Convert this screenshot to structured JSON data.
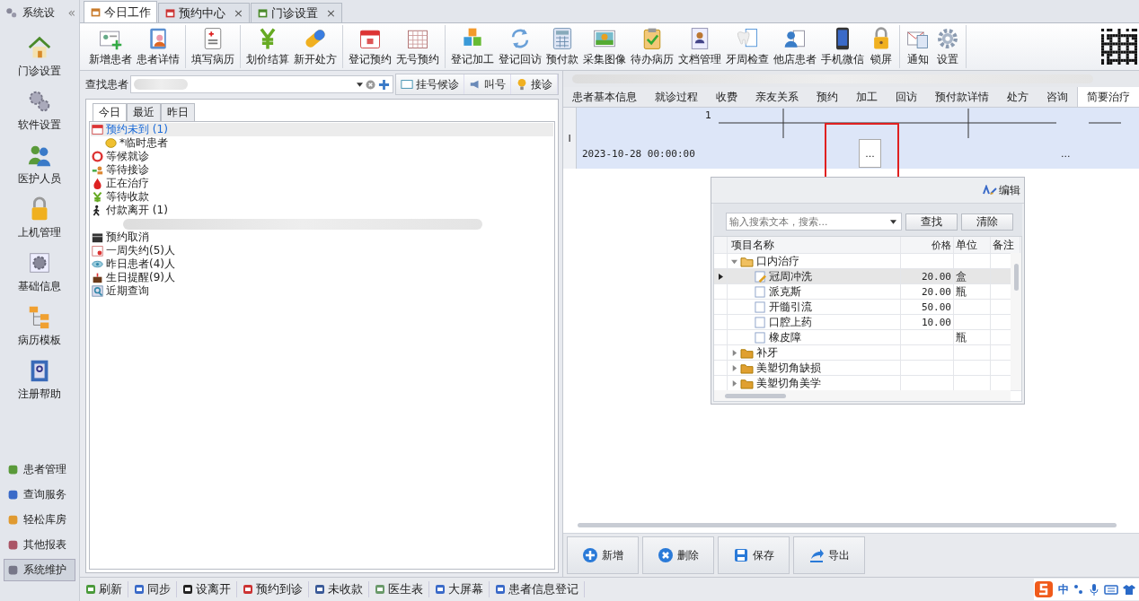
{
  "sidebar": {
    "title": "系统设",
    "collapse": "«",
    "items": [
      {
        "label": "门诊设置"
      },
      {
        "label": "软件设置"
      },
      {
        "label": "医护人员"
      },
      {
        "label": "上机管理"
      },
      {
        "label": "基础信息"
      },
      {
        "label": "病历模板"
      },
      {
        "label": "注册帮助"
      }
    ],
    "modules": [
      {
        "label": "患者管理",
        "selected": false
      },
      {
        "label": "查询服务",
        "selected": false
      },
      {
        "label": "轻松库房",
        "selected": false
      },
      {
        "label": "其他报表",
        "selected": false
      },
      {
        "label": "系统维护",
        "selected": true
      }
    ]
  },
  "tabs": [
    {
      "label": "今日工作",
      "selected": true,
      "closable": false
    },
    {
      "label": "预约中心",
      "selected": false,
      "closable": true
    },
    {
      "label": "门诊设置",
      "selected": false,
      "closable": true
    }
  ],
  "tab_close": "×",
  "toolbar": [
    [
      "新增患者",
      "患者详情"
    ],
    [
      "填写病历"
    ],
    [
      "划价结算",
      "新开处方"
    ],
    [
      "登记预约",
      "无号预约"
    ],
    [
      "登记加工",
      "登记回访",
      "预付款",
      "采集图像",
      "待办病历",
      "文档管理",
      "牙周检查",
      "他店患者",
      "手机微信",
      "锁屏"
    ],
    [
      "通知",
      "设置"
    ]
  ],
  "patient_search": {
    "label": "查找患者",
    "buttons": [
      "挂号候诊",
      "叫号",
      "接诊"
    ]
  },
  "queue": {
    "tabs": [
      {
        "label": "今日",
        "selected": true
      },
      {
        "label": "最近",
        "selected": false
      },
      {
        "label": "昨日",
        "selected": false
      }
    ],
    "items": [
      {
        "label": "预约未到 (1)",
        "selected": true,
        "children": [
          {
            "label": "*临时患者",
            "kind": "patient"
          }
        ]
      },
      {
        "label": "等候就诊",
        "selected": false
      },
      {
        "label": "等待接诊",
        "selected": false
      },
      {
        "label": "正在治疗",
        "selected": false
      },
      {
        "label": "等待收款",
        "selected": false
      },
      {
        "label": "付款离开 (1)",
        "selected": false,
        "children": [
          {
            "kind": "blurred"
          }
        ]
      },
      {
        "label": "预约取消",
        "selected": false
      },
      {
        "label": "一周失约(5)人",
        "selected": false
      },
      {
        "label": "昨日患者(4)人",
        "selected": false
      },
      {
        "label": "生日提醒(9)人",
        "selected": false
      },
      {
        "label": "近期查询",
        "selected": false
      }
    ]
  },
  "detail": {
    "tabs": [
      {
        "label": "患者基本信息",
        "selected": false
      },
      {
        "label": "就诊过程",
        "selected": false
      },
      {
        "label": "收费",
        "selected": false
      },
      {
        "label": "亲友关系",
        "selected": false
      },
      {
        "label": "预约",
        "selected": false
      },
      {
        "label": "加工",
        "selected": false
      },
      {
        "label": "回访",
        "selected": false
      },
      {
        "label": "预付款详情",
        "selected": false
      },
      {
        "label": "处方",
        "selected": false
      },
      {
        "label": "咨询",
        "selected": false
      },
      {
        "label": "简要治疗",
        "selected": true
      }
    ],
    "record": {
      "row_marker": "I",
      "number": "1",
      "datetime": "2023-10-28 00:00:00",
      "edit_button": "...",
      "more": "..."
    },
    "highlight": true,
    "picker": {
      "edit": "编辑",
      "search_placeholder": "输入搜索文本，搜索...",
      "find": "查找",
      "clear": "清除",
      "columns": [
        "项目名称",
        "价格",
        "单位",
        "备注"
      ],
      "groups": [
        {
          "name": "口内治疗",
          "expanded": true,
          "items": [
            {
              "name": "冠周冲洗",
              "price": "20.00",
              "unit": "盒",
              "selected": true
            },
            {
              "name": "派克斯",
              "price": "20.00",
              "unit": "瓶",
              "selected": false
            },
            {
              "name": "开髓引流",
              "price": "50.00",
              "selected": false
            },
            {
              "name": "口腔上药",
              "price": "10.00",
              "selected": false
            },
            {
              "name": "橡皮障",
              "unit": "瓶",
              "selected": false
            }
          ]
        },
        {
          "name": "补牙",
          "expanded": false
        },
        {
          "name": "美塑切角缺损",
          "expanded": false
        },
        {
          "name": "美塑切角美学",
          "expanded": false
        }
      ]
    },
    "actions": [
      "新增",
      "删除",
      "保存",
      "导出"
    ]
  },
  "status_bar": {
    "items": [
      "刷新",
      "同步",
      "设离开",
      "预约到诊",
      "未收款",
      "医生表",
      "大屏幕",
      "患者信息登记"
    ],
    "ime": "中"
  }
}
